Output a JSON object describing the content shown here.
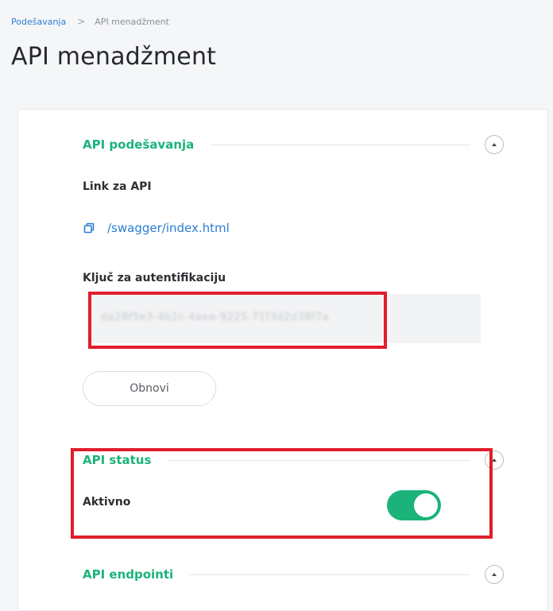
{
  "breadcrumb": {
    "parent": "Podešavanja",
    "separator": ">",
    "current": "API menadžment"
  },
  "page": {
    "title": "API menadžment"
  },
  "sections": {
    "api_settings": {
      "title": "API podešavanja",
      "link_label": "Link za API",
      "link_url": "/swagger/index.html",
      "key_label": "Ključ za autentifikaciju",
      "key_value": "da28f5e3-4b1c-4aea-9225-71f3d2d38f7a",
      "refresh_button": "Obnovi"
    },
    "api_status": {
      "title": "API status",
      "active_label": "Aktivno",
      "active": true
    },
    "api_endpoints": {
      "title": "API endpointi"
    }
  },
  "colors": {
    "accent": "#1bb37a",
    "link": "#2a7fd4",
    "highlight": "#e01e2a"
  }
}
